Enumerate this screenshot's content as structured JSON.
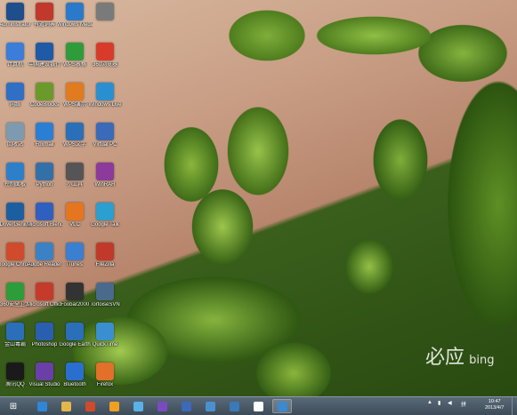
{
  "desktop": {
    "icons": [
      {
        "label": "Administrator",
        "icon": "user-folder-icon",
        "color": "#1f4e8c"
      },
      {
        "label": "计算机",
        "icon": "computer-icon",
        "color": "#3b7dd8"
      },
      {
        "label": "网络",
        "icon": "network-icon",
        "color": "#2f6fc4"
      },
      {
        "label": "回收站",
        "icon": "recycle-bin-icon",
        "color": "#7d9bb0"
      },
      {
        "label": "控制面板",
        "icon": "control-panel-icon",
        "color": "#2e7fc9"
      },
      {
        "label": "DriverGenius",
        "icon": "driver-icon",
        "color": "#1c5fa0"
      },
      {
        "label": "Google Chrome",
        "icon": "chrome-icon",
        "color": "#d04a2c"
      },
      {
        "label": "360安全卫士",
        "icon": "shield-icon",
        "color": "#2d9c3a"
      },
      {
        "label": "金山毒霸",
        "icon": "antivirus-icon",
        "color": "#2a6fb8"
      },
      {
        "label": "腾讯QQ",
        "icon": "qq-icon",
        "color": "#1a1a1a"
      },
      {
        "label": "有道词典",
        "icon": "dictionary-icon",
        "color": "#c0392b"
      },
      {
        "label": "中国建设银行",
        "icon": "bank-icon",
        "color": "#1f5aa6"
      },
      {
        "label": "CodeBlocks",
        "icon": "codeblocks-icon",
        "color": "#6a9a2a"
      },
      {
        "label": "Foxmail",
        "icon": "foxmail-icon",
        "color": "#2a7fd4"
      },
      {
        "label": "Python",
        "icon": "python-icon",
        "color": "#3470a8"
      },
      {
        "label": "Microsoft Blend for",
        "icon": "blend-icon",
        "color": "#2f5fbf"
      },
      {
        "label": "Adobe Reader",
        "icon": "pdf-icon",
        "color": "#3b82c4"
      },
      {
        "label": "Microsoft Office",
        "icon": "office-icon",
        "color": "#c43b2c"
      },
      {
        "label": "Photoshop",
        "icon": "photoshop-icon",
        "color": "#2a5fb0"
      },
      {
        "label": "Visual Studio",
        "icon": "visual-studio-icon",
        "color": "#6a3fa8"
      },
      {
        "label": "Windows Media",
        "icon": "media-player-icon",
        "color": "#2b79c9"
      },
      {
        "label": "WPS表格",
        "icon": "wps-sheet-icon",
        "color": "#2f9c3b"
      },
      {
        "label": "WPS演示",
        "icon": "wps-presentation-icon",
        "color": "#e07b20"
      },
      {
        "label": "WPS文字",
        "icon": "wps-writer-icon",
        "color": "#2a6fb8"
      },
      {
        "label": "小工具",
        "icon": "gadget-icon",
        "color": "#555555"
      },
      {
        "label": "VLC",
        "icon": "vlc-icon",
        "color": "#e5751f"
      },
      {
        "label": "iTunes",
        "icon": "itunes-icon",
        "color": "#3a7fd0"
      },
      {
        "label": "Foobar2000",
        "icon": "foobar-icon",
        "color": "#333333"
      },
      {
        "label": "Google Earth",
        "icon": "earth-icon",
        "color": "#2a6fb8"
      },
      {
        "label": "Bluetooth",
        "icon": "bluetooth-icon",
        "color": "#2a6fd0"
      },
      {
        "label": "",
        "icon": "app-icon",
        "color": "#7a7a7a"
      },
      {
        "label": "360浏览器",
        "icon": "browser-icon",
        "color": "#d83b2c"
      },
      {
        "label": "Windows Live",
        "icon": "messenger-icon",
        "color": "#2a8fd0"
      },
      {
        "label": "Virtual PC",
        "icon": "vm-icon",
        "color": "#3a6ab8"
      },
      {
        "label": "WinRAR",
        "icon": "archive-icon",
        "color": "#8c3a9c"
      },
      {
        "label": "Google Talk",
        "icon": "talk-icon",
        "color": "#2a9fd0"
      },
      {
        "label": "FileZilla",
        "icon": "filezilla-icon",
        "color": "#c0392b"
      },
      {
        "label": "TortoiseSVN",
        "icon": "svn-icon",
        "color": "#4a6a8c"
      },
      {
        "label": "QuickTime",
        "icon": "quicktime-icon",
        "color": "#3a8fd0"
      },
      {
        "label": "Firefox",
        "icon": "firefox-icon",
        "color": "#e0702a"
      }
    ]
  },
  "wallpaper": {
    "watermark_zh": "必应",
    "watermark_en": "bing"
  },
  "taskbar": {
    "buttons": [
      {
        "icon": "internet-explorer-icon",
        "color": "#2f86d6"
      },
      {
        "icon": "file-explorer-icon",
        "color": "#e5b64a"
      },
      {
        "icon": "chrome-icon",
        "color": "#d04a2c"
      },
      {
        "icon": "foxmail-icon",
        "color": "#f0a020"
      },
      {
        "icon": "network-icon",
        "color": "#5ab0e8"
      },
      {
        "icon": "visual-studio-icon",
        "color": "#7a4ac0"
      },
      {
        "icon": "monitor-icon",
        "color": "#3a6ab8"
      },
      {
        "icon": "tool-icon",
        "color": "#4a90d0"
      },
      {
        "icon": "settings-icon",
        "color": "#3a7ab8"
      },
      {
        "icon": "app-icon",
        "color": "#ffffff"
      },
      {
        "icon": "window-icon",
        "color": "#3a8ad0"
      }
    ],
    "tray_text": "拼",
    "clock_time": "10:47",
    "clock_date": "2013/4/7"
  }
}
